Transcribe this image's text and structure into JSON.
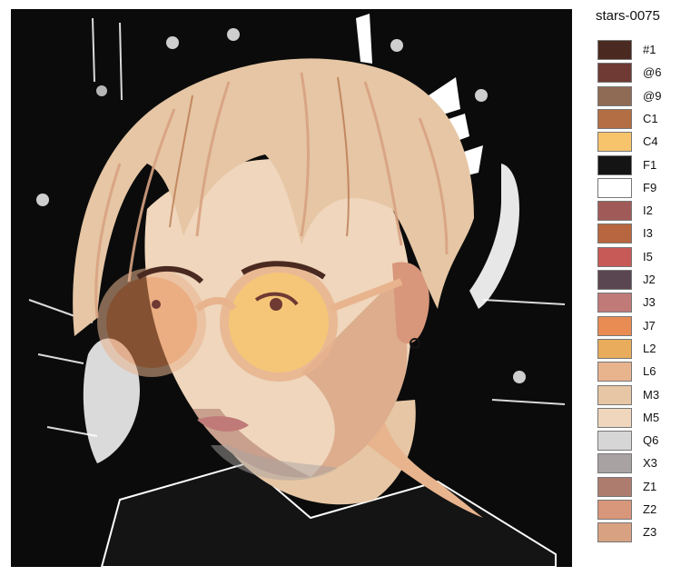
{
  "product_code": "stars-0075",
  "palette": [
    {
      "code": "#1",
      "color": "#4a2a20"
    },
    {
      "code": "@6",
      "color": "#6e3a33"
    },
    {
      "code": "@9",
      "color": "#8f6a55"
    },
    {
      "code": "C1",
      "color": "#b46e44"
    },
    {
      "code": "C4",
      "color": "#f7c46c"
    },
    {
      "code": "F1",
      "color": "#141414"
    },
    {
      "code": "F9",
      "color": "#ffffff"
    },
    {
      "code": "I2",
      "color": "#a05a58"
    },
    {
      "code": "I3",
      "color": "#b86640"
    },
    {
      "code": "I5",
      "color": "#c75a56"
    },
    {
      "code": "J2",
      "color": "#5a4650"
    },
    {
      "code": "J3",
      "color": "#c07a78"
    },
    {
      "code": "J7",
      "color": "#e88c54"
    },
    {
      "code": "L2",
      "color": "#e8ac5c"
    },
    {
      "code": "L6",
      "color": "#e8b48e"
    },
    {
      "code": "M3",
      "color": "#e6c6a4"
    },
    {
      "code": "M5",
      "color": "#efd6bc"
    },
    {
      "code": "Q6",
      "color": "#d6d6d6"
    },
    {
      "code": "X3",
      "color": "#a8a2a2"
    },
    {
      "code": "Z1",
      "color": "#ad7c6e"
    },
    {
      "code": "Z2",
      "color": "#d8967a"
    },
    {
      "code": "Z3",
      "color": "#d8a282"
    }
  ]
}
